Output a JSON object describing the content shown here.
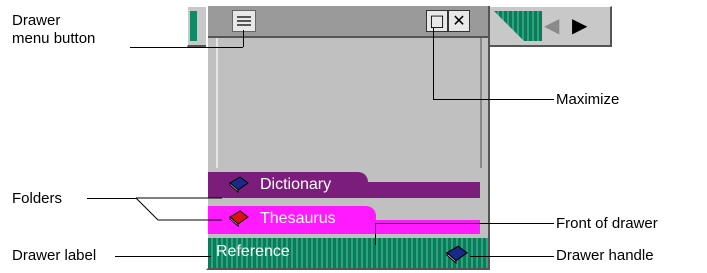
{
  "callouts": {
    "drawer_menu_button": "Drawer\nmenu button",
    "maximize": "Maximize",
    "folders": "Folders",
    "front_of_drawer": "Front of drawer",
    "drawer_label": "Drawer label",
    "drawer_handle": "Drawer handle"
  },
  "drawer": {
    "folders": [
      {
        "label": "Dictionary",
        "color": "#7b1e7b",
        "icon": "blue-book-icon"
      },
      {
        "label": "Thesaurus",
        "color": "#ff1aff",
        "icon": "red-book-icon"
      }
    ],
    "label": "Reference",
    "title_buttons": [
      "maximize-icon",
      "close-icon"
    ]
  },
  "colors": {
    "drawer_green": "#0f7a5a",
    "folder_purple": "#7b1e7b",
    "folder_magenta": "#ff1aff"
  }
}
